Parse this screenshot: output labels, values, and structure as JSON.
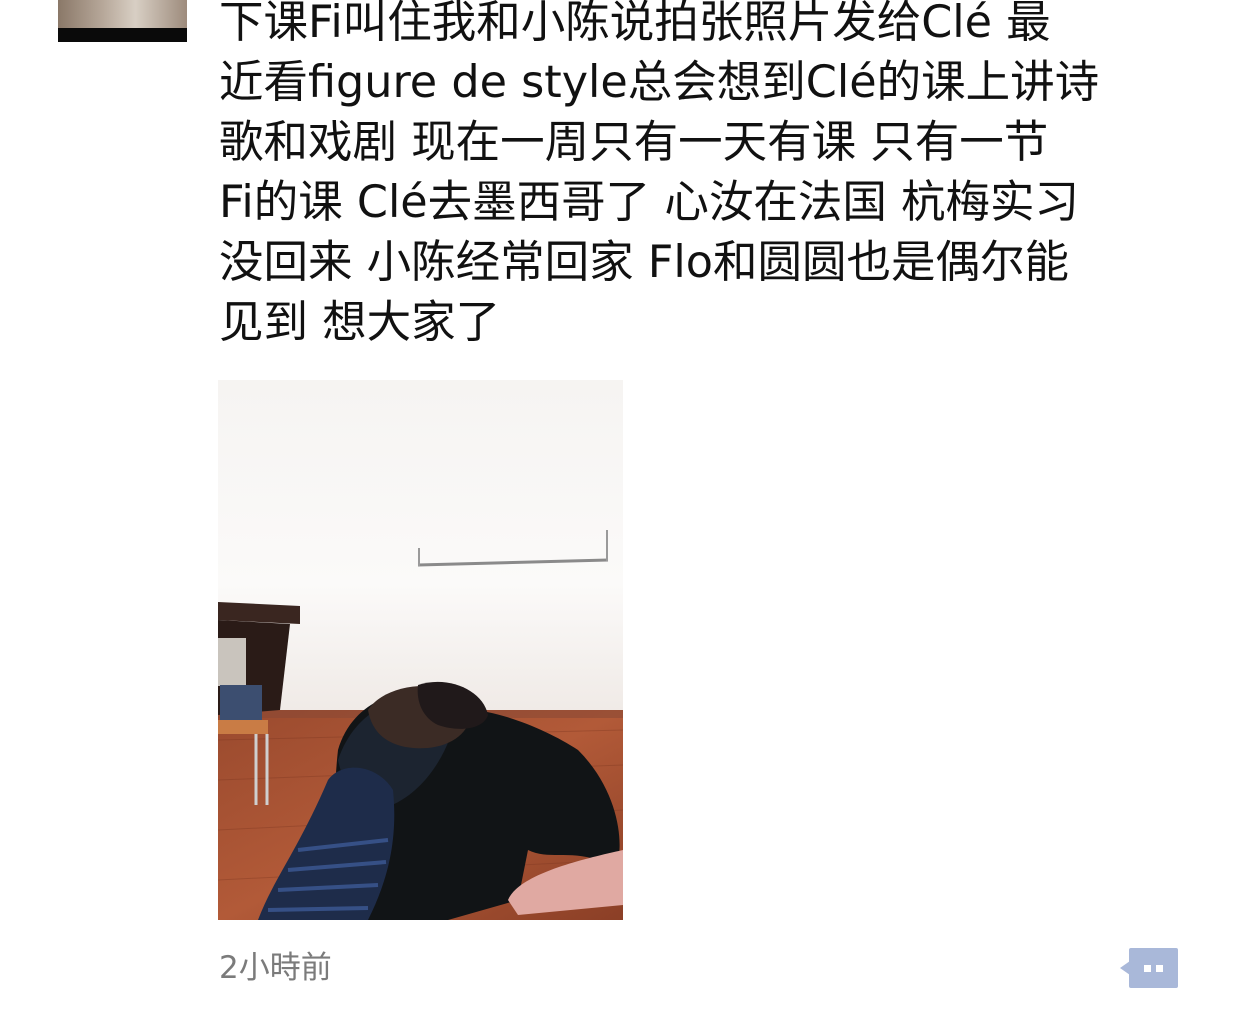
{
  "post": {
    "text_lines": [
      "下课Fi叫住我和小陈说拍张照片发给Clé 最",
      "近看figure de style总会想到Clé的课上讲诗",
      "歌和戏剧 现在一周只有一天有课 只有一节",
      "Fi的课 Clé去墨西哥了 心汝在法国 杭梅实习",
      "没回来 小陈经常回家 Flo和圆圆也是偶尔能",
      "见到 想大家了"
    ],
    "timestamp": "2小時前"
  },
  "icons": {
    "comment": "comment-more-icon"
  },
  "colors": {
    "text": "#111111",
    "timestamp": "#7b7b7b",
    "comment_button_bg": "#a9b8d9",
    "comment_button_dots": "#ffffff"
  }
}
